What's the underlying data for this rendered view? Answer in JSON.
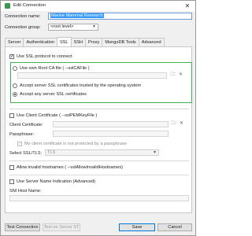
{
  "window": {
    "title": "Edit Connection",
    "close_glyph": "✕"
  },
  "connection_name": {
    "label": "Connection name:",
    "value": "Marine Mammal Research"
  },
  "connection_group": {
    "label": "Connection group:",
    "value": "<root level>"
  },
  "tabs": [
    {
      "label": "Server"
    },
    {
      "label": "Authentication"
    },
    {
      "label": "SSL"
    },
    {
      "label": "SSH"
    },
    {
      "label": "Proxy"
    },
    {
      "label": "MongoDB Tools"
    },
    {
      "label": "Advanced"
    }
  ],
  "ssl": {
    "use_ssl_label": "Use SSL protocol to connect",
    "own_ca_label": "Use own Root CA file ( --sslCAFile )",
    "accept_trusted_label": "Accept server SSL certificates trusted by the operating system",
    "accept_any_label": "Accept any server SSL certificates",
    "client_cert_check_label": "Use Client Certificate ( --sslPEMKeyFile )",
    "client_cert_label": "Client Certificate:",
    "passphrase_label": "Passphrase:",
    "not_protected_label": "My client certificate is not protected by a passphrase",
    "ssl_tls_label": "Select SSL/TLS:",
    "ssl_tls_value": "TLS",
    "allow_invalid_label": "Allow invalid hostnames ( --sslAllowInvalidHostnames)",
    "sni_check_label": "Use Server Name Indication (Advanced)",
    "sni_host_label": "SNI Host Name:"
  },
  "footer": {
    "test_connection": "Test Connection",
    "test_ssh": "Test on Server ST",
    "save": "Save",
    "cancel": "Cancel"
  },
  "colors": {
    "highlight_box": "#3fb34f",
    "selection": "#3399ff",
    "primary_border": "#0078d7"
  },
  "icons": {
    "app": "app-icon",
    "folder": "folder-icon",
    "close": "close-icon",
    "dropdown": "chevron-down-icon"
  }
}
